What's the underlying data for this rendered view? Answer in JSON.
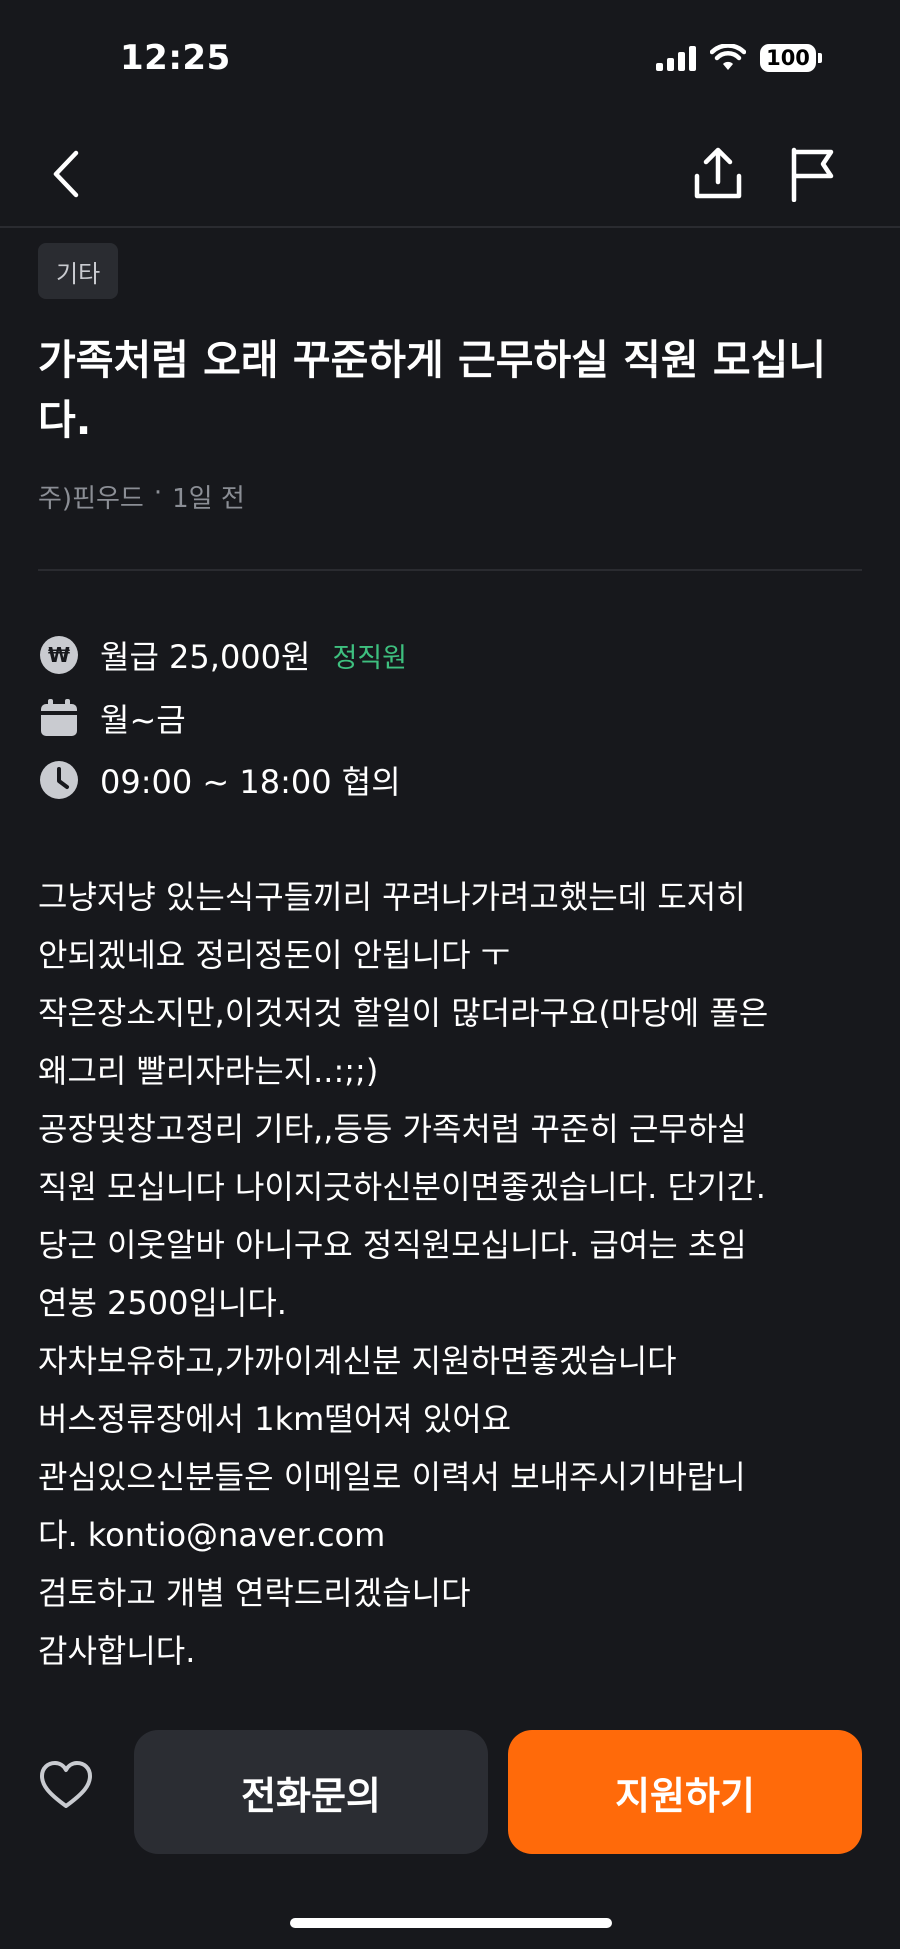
{
  "status_bar": {
    "time": "12:25",
    "battery": "100"
  },
  "post": {
    "category": "기타",
    "title": "가족처럼 오래 꾸준하게 근무하실 직원 모십니다.",
    "author": "주)핀우드",
    "separator": "·",
    "posted": "1일 전"
  },
  "info": {
    "salary": "월급 25,000원",
    "employment_type": "정직원",
    "days": "월~금",
    "hours": "09:00 ~ 18:00 협의",
    "icons": [
      "won-icon",
      "calendar-icon",
      "clock-icon"
    ]
  },
  "description": [
    "그냥저냥 있는식구들끼리 꾸려나가려고했는데 도저히",
    "안되겠네요 정리정돈이 안됩니다 ㅜ",
    "작은장소지만,이것저것 할일이 많더라구요(마당에 풀은",
    "왜그리 빨리자라는지..:;;)",
    "공장및창고정리 기타,,등등 가족처럼 꾸준히 근무하실",
    "직원 모십니다 나이지긋하신분이면좋겠습니다. 단기간.",
    "당근 이웃알바 아니구요 정직원모십니다. 급여는 초임",
    "연봉 2500입니다.",
    "자차보유하고,가까이계신분 지원하면좋겠습니다",
    "버스정류장에서 1km떨어져 있어요",
    "관심있으신분들은 이메일로 이력서 보내주시기바랍니",
    "다. kontio@naver.com",
    "검토하고 개별 연락드리겠습니다",
    "감사합니다."
  ],
  "actions": {
    "call_label": "전화문의",
    "apply_label": "지원하기"
  },
  "colors": {
    "background": "#17181c",
    "accent": "#ff6a0a",
    "employment_type": "#3ec07f"
  }
}
